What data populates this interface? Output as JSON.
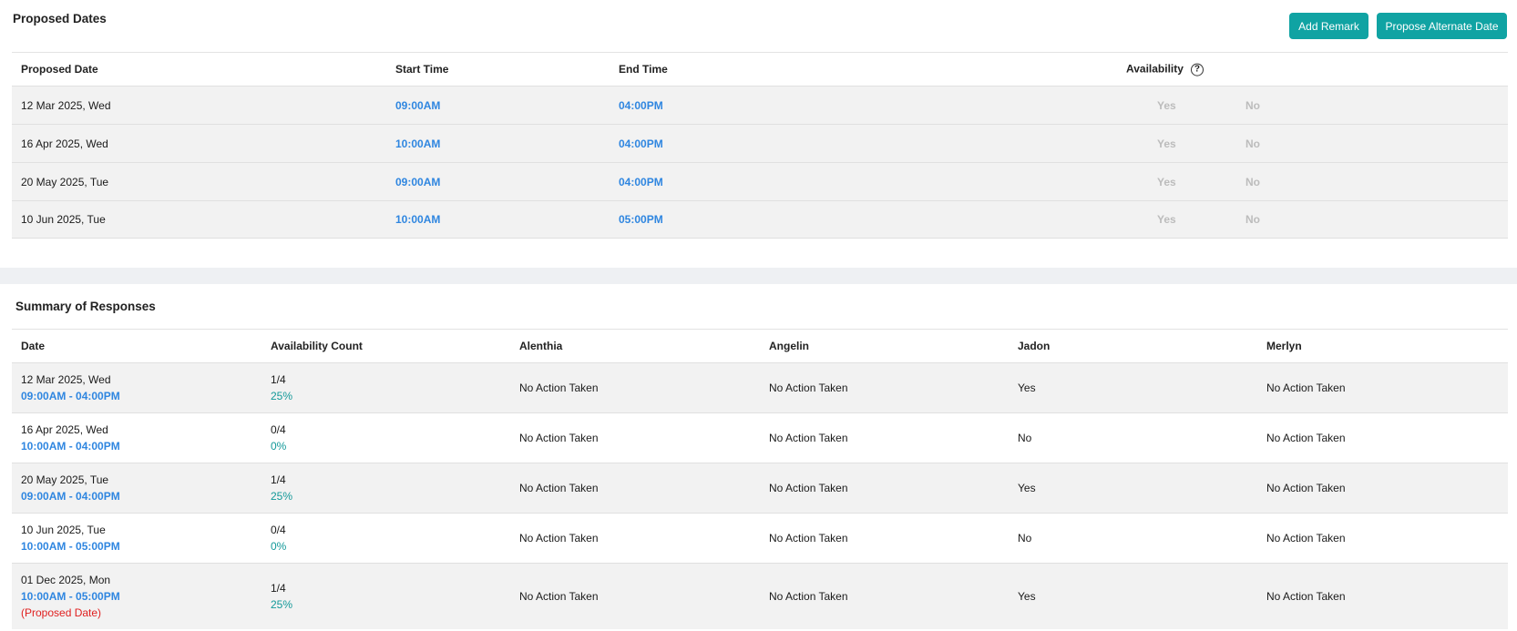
{
  "proposed_dates": {
    "title": "Proposed Dates",
    "buttons": {
      "add_remark": "Add Remark",
      "propose_alternate": "Propose Alternate Date"
    },
    "headers": {
      "date": "Proposed Date",
      "start": "Start Time",
      "end": "End Time",
      "availability": "Availability"
    },
    "help_glyph": "?",
    "rows": [
      {
        "date": "12 Mar 2025, Wed",
        "start": "09:00AM",
        "end": "04:00PM",
        "yes": "Yes",
        "no": "No"
      },
      {
        "date": "16 Apr 2025, Wed",
        "start": "10:00AM",
        "end": "04:00PM",
        "yes": "Yes",
        "no": "No"
      },
      {
        "date": "20 May 2025, Tue",
        "start": "09:00AM",
        "end": "04:00PM",
        "yes": "Yes",
        "no": "No"
      },
      {
        "date": "10 Jun 2025, Tue",
        "start": "10:00AM",
        "end": "05:00PM",
        "yes": "Yes",
        "no": "No"
      }
    ]
  },
  "summary": {
    "title": "Summary of Responses",
    "headers": {
      "date": "Date",
      "count": "Availability Count",
      "p1": "Alenthia",
      "p2": "Angelin",
      "p3": "Jadon",
      "p4": "Merlyn"
    },
    "rows": [
      {
        "date": "12 Mar 2025, Wed",
        "time": "09:00AM - 04:00PM",
        "count": "1/4",
        "pct": "25%",
        "p1": "No Action Taken",
        "p2": "No Action Taken",
        "p3": "Yes",
        "p4": "No Action Taken"
      },
      {
        "date": "16 Apr 2025, Wed",
        "time": "10:00AM - 04:00PM",
        "count": "0/4",
        "pct": "0%",
        "p1": "No Action Taken",
        "p2": "No Action Taken",
        "p3": "No",
        "p4": "No Action Taken"
      },
      {
        "date": "20 May 2025, Tue",
        "time": "09:00AM - 04:00PM",
        "count": "1/4",
        "pct": "25%",
        "p1": "No Action Taken",
        "p2": "No Action Taken",
        "p3": "Yes",
        "p4": "No Action Taken"
      },
      {
        "date": "10 Jun 2025, Tue",
        "time": "10:00AM - 05:00PM",
        "count": "0/4",
        "pct": "0%",
        "p1": "No Action Taken",
        "p2": "No Action Taken",
        "p3": "No",
        "p4": "No Action Taken"
      },
      {
        "date": "01 Dec 2025, Mon",
        "time": "10:00AM - 05:00PM",
        "note": "(Proposed Date)",
        "count": "1/4",
        "pct": "25%",
        "p1": "No Action Taken",
        "p2": "No Action Taken",
        "p3": "Yes",
        "p4": "No Action Taken"
      }
    ]
  },
  "colors": {
    "accent_button": "#10a3a3",
    "time_blue": "#2f86e0",
    "percent_teal": "#139999",
    "proposed_red": "#e02020",
    "disabled_grey": "#bcbcbc"
  }
}
